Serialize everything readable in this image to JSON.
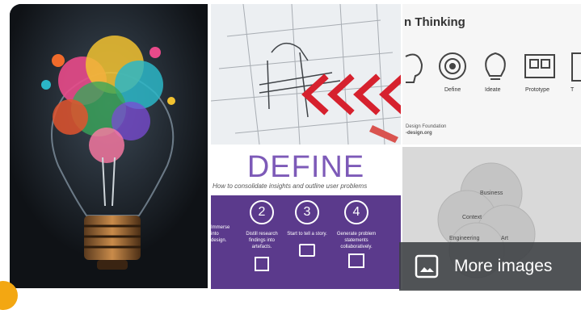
{
  "tiles": {
    "design_thinking": {
      "title": "n Thinking",
      "stages": [
        "Define",
        "Ideate",
        "Prototype",
        "T"
      ],
      "credit_line1": "Design Foundation",
      "credit_line2": "-design.org"
    },
    "define": {
      "title": "DEFINE",
      "subtitle": "How to consolidate insights and outline user problems",
      "steps": [
        {
          "num": "2",
          "text": "Distill research findings into artefacts."
        },
        {
          "num": "3",
          "text": "Start to tell a story."
        },
        {
          "num": "4",
          "text": "Generate problem statements collaboratively."
        }
      ],
      "partial_left_text": "Immerse into design."
    },
    "venn": {
      "labels": [
        "Business",
        "Context",
        "Engineering",
        "Art"
      ]
    }
  },
  "more_images": {
    "label": "More images",
    "icon": "image-icon"
  },
  "colors": {
    "define_purple": "#5b3a8c",
    "arrow_red": "#d6212e",
    "overlay": "#3c4043"
  }
}
